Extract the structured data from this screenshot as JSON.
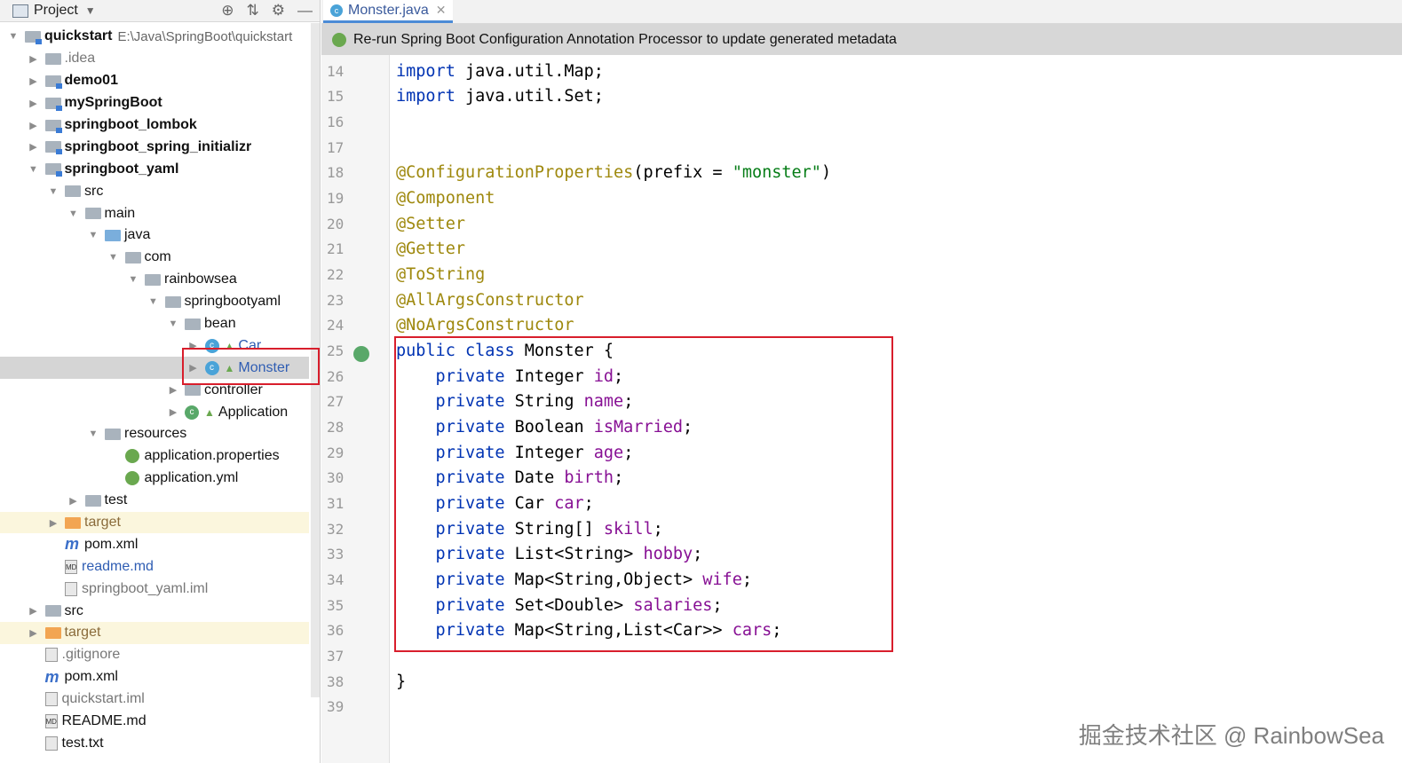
{
  "project_panel": {
    "title": "Project",
    "tree": [
      {
        "depth": 0,
        "expanded": true,
        "icon": "module-folder",
        "label": "quickstart",
        "bold": true,
        "path": "E:\\Java\\SpringBoot\\quickstart"
      },
      {
        "depth": 1,
        "expanded": false,
        "icon": "folder",
        "label": ".idea",
        "color": "gray"
      },
      {
        "depth": 1,
        "expanded": false,
        "icon": "module-folder",
        "label": "demo01",
        "bold": true
      },
      {
        "depth": 1,
        "expanded": false,
        "icon": "module-folder",
        "label": "mySpringBoot",
        "bold": true
      },
      {
        "depth": 1,
        "expanded": false,
        "icon": "module-folder",
        "label": "springboot_lombok",
        "bold": true
      },
      {
        "depth": 1,
        "expanded": false,
        "icon": "module-folder",
        "label": "springboot_spring_initializr",
        "bold": true
      },
      {
        "depth": 1,
        "expanded": true,
        "icon": "module-folder",
        "label": "springboot_yaml",
        "bold": true
      },
      {
        "depth": 2,
        "expanded": true,
        "icon": "folder",
        "label": "src"
      },
      {
        "depth": 3,
        "expanded": true,
        "icon": "folder",
        "label": "main"
      },
      {
        "depth": 4,
        "expanded": true,
        "icon": "source-folder",
        "label": "java"
      },
      {
        "depth": 5,
        "expanded": true,
        "icon": "package",
        "label": "com"
      },
      {
        "depth": 6,
        "expanded": true,
        "icon": "package",
        "label": "rainbowsea"
      },
      {
        "depth": 7,
        "expanded": true,
        "icon": "package",
        "label": "springbootyaml"
      },
      {
        "depth": 8,
        "expanded": true,
        "icon": "package",
        "label": "bean"
      },
      {
        "depth": 9,
        "expanded": false,
        "icon": "class",
        "label": "Car",
        "color": "blue"
      },
      {
        "depth": 9,
        "expanded": false,
        "icon": "class",
        "label": "Monster",
        "color": "blue",
        "selected": true
      },
      {
        "depth": 8,
        "expanded": false,
        "icon": "package",
        "label": "controller"
      },
      {
        "depth": 8,
        "expanded": false,
        "icon": "spring-class",
        "label": "Application"
      },
      {
        "depth": 4,
        "expanded": true,
        "icon": "resources-folder",
        "label": "resources"
      },
      {
        "depth": 5,
        "expanded": null,
        "icon": "spring-config",
        "label": "application.properties"
      },
      {
        "depth": 5,
        "expanded": null,
        "icon": "spring-config",
        "label": "application.yml"
      },
      {
        "depth": 3,
        "expanded": false,
        "icon": "folder",
        "label": "test"
      },
      {
        "depth": 2,
        "expanded": false,
        "icon": "excluded-folder",
        "label": "target",
        "color": "orange",
        "excluded": true
      },
      {
        "depth": 2,
        "expanded": null,
        "icon": "maven",
        "label": "pom.xml"
      },
      {
        "depth": 2,
        "expanded": null,
        "icon": "markdown",
        "label": "readme.md",
        "color": "blue"
      },
      {
        "depth": 2,
        "expanded": null,
        "icon": "iml",
        "label": "springboot_yaml.iml",
        "color": "gray"
      },
      {
        "depth": 1,
        "expanded": false,
        "icon": "folder",
        "label": "src"
      },
      {
        "depth": 1,
        "expanded": false,
        "icon": "excluded-folder",
        "label": "target",
        "color": "orange",
        "excluded": true
      },
      {
        "depth": 1,
        "expanded": null,
        "icon": "gitignore",
        "label": ".gitignore",
        "color": "gray"
      },
      {
        "depth": 1,
        "expanded": null,
        "icon": "maven",
        "label": "pom.xml"
      },
      {
        "depth": 1,
        "expanded": null,
        "icon": "iml",
        "label": "quickstart.iml",
        "color": "gray"
      },
      {
        "depth": 1,
        "expanded": null,
        "icon": "markdown",
        "label": "README.md"
      },
      {
        "depth": 1,
        "expanded": null,
        "icon": "text",
        "label": "test.txt"
      }
    ]
  },
  "editor": {
    "tab": {
      "label": "Monster.java"
    },
    "notification": "Re-run Spring Boot Configuration Annotation Processor to update generated metadata",
    "lines": [
      {
        "n": "14",
        "tokens": [
          [
            "kw",
            "import"
          ],
          [
            "",
            "java.util.Map;"
          ]
        ]
      },
      {
        "n": "15",
        "tokens": [
          [
            "kw",
            "import"
          ],
          [
            "",
            "java.util.Set;"
          ]
        ]
      },
      {
        "n": "16",
        "tokens": []
      },
      {
        "n": "17",
        "tokens": []
      },
      {
        "n": "18",
        "tokens": [
          [
            "ann",
            "@ConfigurationProperties"
          ],
          [
            "",
            "(prefix = "
          ],
          [
            "str",
            "\"monster\""
          ],
          [
            "",
            ")"
          ]
        ]
      },
      {
        "n": "19",
        "tokens": [
          [
            "ann",
            "@Component"
          ]
        ]
      },
      {
        "n": "20",
        "tokens": [
          [
            "ann",
            "@Setter"
          ]
        ]
      },
      {
        "n": "21",
        "tokens": [
          [
            "ann",
            "@Getter"
          ]
        ]
      },
      {
        "n": "22",
        "tokens": [
          [
            "ann",
            "@ToString"
          ]
        ]
      },
      {
        "n": "23",
        "tokens": [
          [
            "ann",
            "@AllArgsConstructor"
          ]
        ]
      },
      {
        "n": "24",
        "tokens": [
          [
            "ann",
            "@NoArgsConstructor"
          ]
        ]
      },
      {
        "n": "25",
        "tokens": [
          [
            "kw",
            "public class "
          ],
          [
            "",
            "Monster {"
          ]
        ],
        "run": true
      },
      {
        "n": "26",
        "tokens": [
          [
            "kw",
            "    private "
          ],
          [
            "",
            "Integer "
          ],
          [
            "fld",
            "id"
          ],
          [
            "",
            ";"
          ]
        ]
      },
      {
        "n": "27",
        "tokens": [
          [
            "kw",
            "    private "
          ],
          [
            "",
            "String "
          ],
          [
            "fld",
            "name"
          ],
          [
            "",
            ";"
          ]
        ]
      },
      {
        "n": "28",
        "tokens": [
          [
            "kw",
            "    private "
          ],
          [
            "",
            "Boolean "
          ],
          [
            "fld",
            "isMarried"
          ],
          [
            "",
            ";"
          ]
        ]
      },
      {
        "n": "29",
        "tokens": [
          [
            "kw",
            "    private "
          ],
          [
            "",
            "Integer "
          ],
          [
            "fld",
            "age"
          ],
          [
            "",
            ";"
          ]
        ]
      },
      {
        "n": "30",
        "tokens": [
          [
            "kw",
            "    private "
          ],
          [
            "",
            "Date "
          ],
          [
            "fld",
            "birth"
          ],
          [
            "",
            ";"
          ]
        ]
      },
      {
        "n": "31",
        "tokens": [
          [
            "kw",
            "    private "
          ],
          [
            "",
            "Car "
          ],
          [
            "fld",
            "car"
          ],
          [
            "",
            ";"
          ]
        ]
      },
      {
        "n": "32",
        "tokens": [
          [
            "kw",
            "    private "
          ],
          [
            "",
            "String[] "
          ],
          [
            "fld",
            "skill"
          ],
          [
            "",
            ";"
          ]
        ]
      },
      {
        "n": "33",
        "tokens": [
          [
            "kw",
            "    private "
          ],
          [
            "",
            "List<String> "
          ],
          [
            "fld",
            "hobby"
          ],
          [
            "",
            ";"
          ]
        ]
      },
      {
        "n": "34",
        "tokens": [
          [
            "kw",
            "    private "
          ],
          [
            "",
            "Map<String,Object> "
          ],
          [
            "fld",
            "wife"
          ],
          [
            "",
            ";"
          ]
        ]
      },
      {
        "n": "35",
        "tokens": [
          [
            "kw",
            "    private "
          ],
          [
            "",
            "Set<Double> "
          ],
          [
            "fld",
            "salaries"
          ],
          [
            "",
            ";"
          ]
        ]
      },
      {
        "n": "36",
        "tokens": [
          [
            "kw",
            "    private "
          ],
          [
            "",
            "Map<String,List<Car>> "
          ],
          [
            "fld",
            "cars"
          ],
          [
            "",
            ";"
          ]
        ]
      },
      {
        "n": "37",
        "tokens": []
      },
      {
        "n": "38",
        "tokens": [
          [
            "",
            "}"
          ]
        ]
      },
      {
        "n": "39",
        "tokens": []
      }
    ]
  },
  "watermark": "掘金技术社区 @ RainbowSea"
}
